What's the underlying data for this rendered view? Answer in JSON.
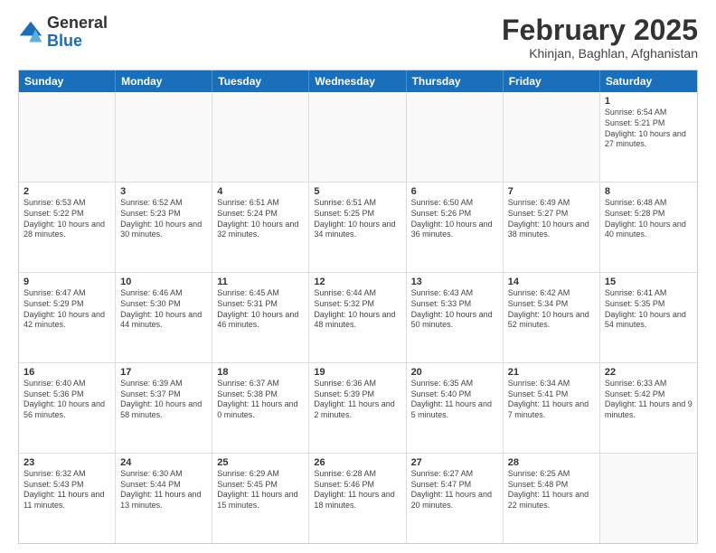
{
  "logo": {
    "line1": "General",
    "line2": "Blue"
  },
  "header": {
    "title": "February 2025",
    "location": "Khinjan, Baghlan, Afghanistan"
  },
  "weekdays": [
    "Sunday",
    "Monday",
    "Tuesday",
    "Wednesday",
    "Thursday",
    "Friday",
    "Saturday"
  ],
  "weeks": [
    [
      {
        "day": "",
        "info": ""
      },
      {
        "day": "",
        "info": ""
      },
      {
        "day": "",
        "info": ""
      },
      {
        "day": "",
        "info": ""
      },
      {
        "day": "",
        "info": ""
      },
      {
        "day": "",
        "info": ""
      },
      {
        "day": "1",
        "info": "Sunrise: 6:54 AM\nSunset: 5:21 PM\nDaylight: 10 hours and 27 minutes."
      }
    ],
    [
      {
        "day": "2",
        "info": "Sunrise: 6:53 AM\nSunset: 5:22 PM\nDaylight: 10 hours and 28 minutes."
      },
      {
        "day": "3",
        "info": "Sunrise: 6:52 AM\nSunset: 5:23 PM\nDaylight: 10 hours and 30 minutes."
      },
      {
        "day": "4",
        "info": "Sunrise: 6:51 AM\nSunset: 5:24 PM\nDaylight: 10 hours and 32 minutes."
      },
      {
        "day": "5",
        "info": "Sunrise: 6:51 AM\nSunset: 5:25 PM\nDaylight: 10 hours and 34 minutes."
      },
      {
        "day": "6",
        "info": "Sunrise: 6:50 AM\nSunset: 5:26 PM\nDaylight: 10 hours and 36 minutes."
      },
      {
        "day": "7",
        "info": "Sunrise: 6:49 AM\nSunset: 5:27 PM\nDaylight: 10 hours and 38 minutes."
      },
      {
        "day": "8",
        "info": "Sunrise: 6:48 AM\nSunset: 5:28 PM\nDaylight: 10 hours and 40 minutes."
      }
    ],
    [
      {
        "day": "9",
        "info": "Sunrise: 6:47 AM\nSunset: 5:29 PM\nDaylight: 10 hours and 42 minutes."
      },
      {
        "day": "10",
        "info": "Sunrise: 6:46 AM\nSunset: 5:30 PM\nDaylight: 10 hours and 44 minutes."
      },
      {
        "day": "11",
        "info": "Sunrise: 6:45 AM\nSunset: 5:31 PM\nDaylight: 10 hours and 46 minutes."
      },
      {
        "day": "12",
        "info": "Sunrise: 6:44 AM\nSunset: 5:32 PM\nDaylight: 10 hours and 48 minutes."
      },
      {
        "day": "13",
        "info": "Sunrise: 6:43 AM\nSunset: 5:33 PM\nDaylight: 10 hours and 50 minutes."
      },
      {
        "day": "14",
        "info": "Sunrise: 6:42 AM\nSunset: 5:34 PM\nDaylight: 10 hours and 52 minutes."
      },
      {
        "day": "15",
        "info": "Sunrise: 6:41 AM\nSunset: 5:35 PM\nDaylight: 10 hours and 54 minutes."
      }
    ],
    [
      {
        "day": "16",
        "info": "Sunrise: 6:40 AM\nSunset: 5:36 PM\nDaylight: 10 hours and 56 minutes."
      },
      {
        "day": "17",
        "info": "Sunrise: 6:39 AM\nSunset: 5:37 PM\nDaylight: 10 hours and 58 minutes."
      },
      {
        "day": "18",
        "info": "Sunrise: 6:37 AM\nSunset: 5:38 PM\nDaylight: 11 hours and 0 minutes."
      },
      {
        "day": "19",
        "info": "Sunrise: 6:36 AM\nSunset: 5:39 PM\nDaylight: 11 hours and 2 minutes."
      },
      {
        "day": "20",
        "info": "Sunrise: 6:35 AM\nSunset: 5:40 PM\nDaylight: 11 hours and 5 minutes."
      },
      {
        "day": "21",
        "info": "Sunrise: 6:34 AM\nSunset: 5:41 PM\nDaylight: 11 hours and 7 minutes."
      },
      {
        "day": "22",
        "info": "Sunrise: 6:33 AM\nSunset: 5:42 PM\nDaylight: 11 hours and 9 minutes."
      }
    ],
    [
      {
        "day": "23",
        "info": "Sunrise: 6:32 AM\nSunset: 5:43 PM\nDaylight: 11 hours and 11 minutes."
      },
      {
        "day": "24",
        "info": "Sunrise: 6:30 AM\nSunset: 5:44 PM\nDaylight: 11 hours and 13 minutes."
      },
      {
        "day": "25",
        "info": "Sunrise: 6:29 AM\nSunset: 5:45 PM\nDaylight: 11 hours and 15 minutes."
      },
      {
        "day": "26",
        "info": "Sunrise: 6:28 AM\nSunset: 5:46 PM\nDaylight: 11 hours and 18 minutes."
      },
      {
        "day": "27",
        "info": "Sunrise: 6:27 AM\nSunset: 5:47 PM\nDaylight: 11 hours and 20 minutes."
      },
      {
        "day": "28",
        "info": "Sunrise: 6:25 AM\nSunset: 5:48 PM\nDaylight: 11 hours and 22 minutes."
      },
      {
        "day": "",
        "info": ""
      }
    ]
  ]
}
